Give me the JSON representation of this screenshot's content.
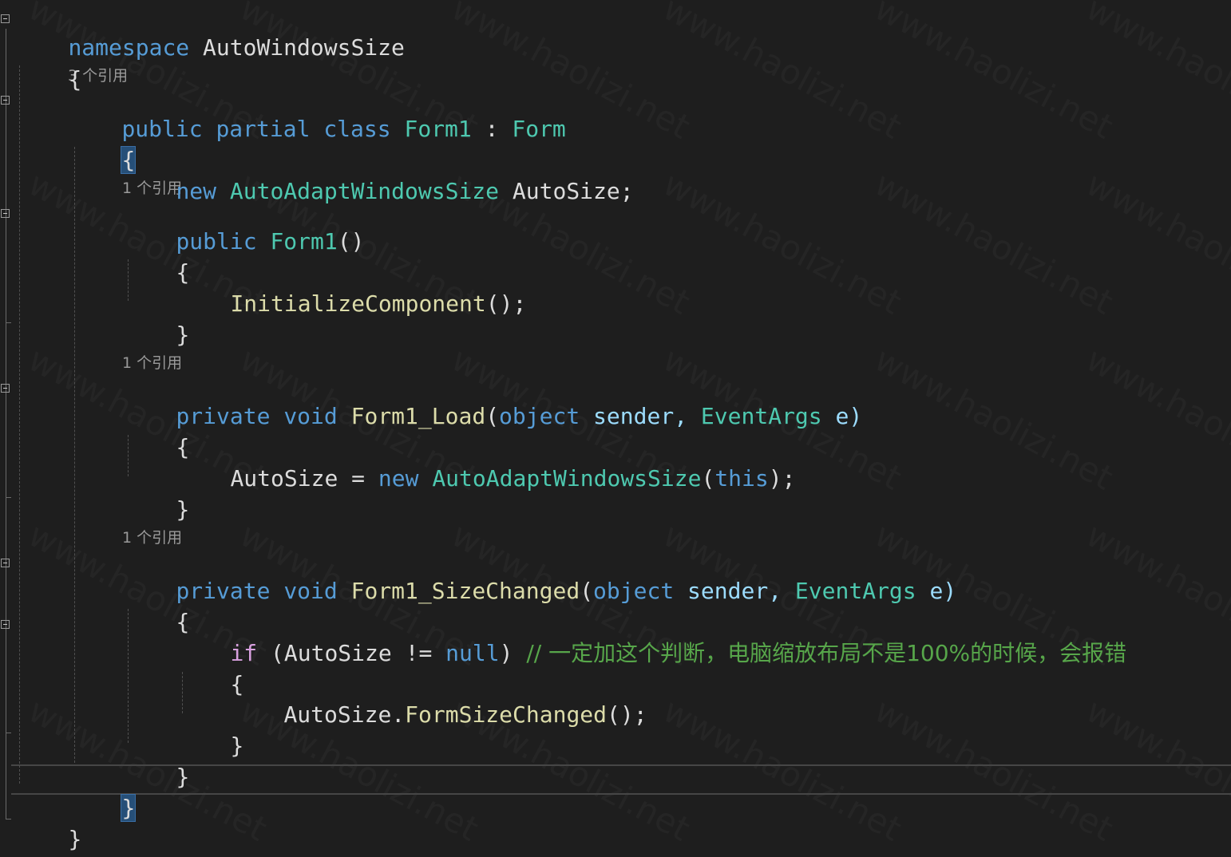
{
  "editor": {
    "code_lens": {
      "class_refs": "3 个引用",
      "ctor_refs": "1 个引用",
      "load_refs": "1 个引用",
      "sizechanged_refs": "1 个引用"
    },
    "lines": {
      "l1": {
        "kw": "namespace",
        "name": " AutoWindowsSize"
      },
      "l2": {
        "text": "{"
      },
      "l3": {
        "kw1": "public",
        "kw2": "partial",
        "kw3": "class",
        "type": "Form1",
        "colon": " : ",
        "base": "Form"
      },
      "l4": {
        "text": "{"
      },
      "l5": {
        "kw": "new",
        "type": "AutoAdaptWindowsSize",
        "rest": " AutoSize;"
      },
      "l6": {
        "kw": "public",
        "method": "Form1",
        "rest": "()"
      },
      "l7": {
        "text": "{"
      },
      "l8": {
        "method": "InitializeComponent",
        "rest": "();"
      },
      "l9": {
        "text": "}"
      },
      "l10": {
        "kw1": "private",
        "kw2": "void",
        "method": "Form1_Load",
        "open": "(",
        "ptype1": "object",
        "p1": " sender, ",
        "ptype2": "EventArgs",
        "p2": " e)"
      },
      "l11": {
        "text": "{"
      },
      "l12": {
        "lhs": "AutoSize = ",
        "kw": "new",
        "type": "AutoAdaptWindowsSize",
        "open": "(",
        "kw2": "this",
        "close": ");"
      },
      "l13": {
        "text": "}"
      },
      "l14": {
        "kw1": "private",
        "kw2": "void",
        "method": "Form1_SizeChanged",
        "open": "(",
        "ptype1": "object",
        "p1": " sender, ",
        "ptype2": "EventArgs",
        "p2": " e)"
      },
      "l15": {
        "text": "{"
      },
      "l16": {
        "kw": "if",
        "cond": " (AutoSize != ",
        "nul": "null",
        "close": ") ",
        "comment": "// 一定加这个判断，电脑缩放布局不是100%的时候，会报错"
      },
      "l17": {
        "text": "{"
      },
      "l18": {
        "obj": "AutoSize.",
        "method": "FormSizeChanged",
        "rest": "();"
      },
      "l19": {
        "text": "}"
      },
      "l20": {
        "text": "}"
      },
      "l21": {
        "text": "}"
      },
      "l22": {
        "text": "}"
      }
    },
    "watermark": "www.haolizi.net"
  }
}
